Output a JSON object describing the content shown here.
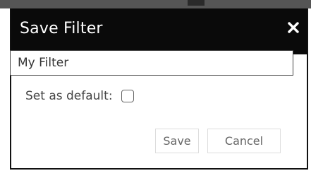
{
  "dialog": {
    "title": "Save Filter",
    "close_icon": "close-icon"
  },
  "name_field": {
    "value": "My Filter"
  },
  "default_option": {
    "label": "Set as default:",
    "checked": false
  },
  "buttons": {
    "save_label": "Save",
    "cancel_label": "Cancel"
  }
}
